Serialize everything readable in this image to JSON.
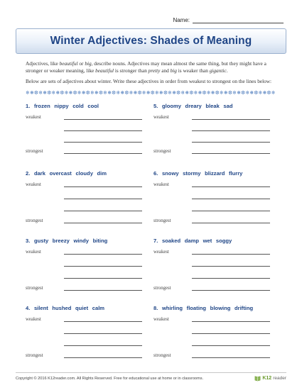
{
  "name_label": "Name:",
  "title": "Winter Adjectives: Shades of Meaning",
  "intro": {
    "p1_a": "Adjectives, like ",
    "p1_b": "beautiful",
    "p1_c": " or ",
    "p1_d": "big",
    "p1_e": ", describe nouns. Adjectives may mean almost the same thing, but they might have a stronger or weaker meaning, like ",
    "p1_f": "beautiful",
    "p1_g": " is stronger than ",
    "p1_h": "pretty",
    "p1_i": " and ",
    "p1_j": "big",
    "p1_k": " is weaker than ",
    "p1_l": "gigantic",
    "p1_m": ".",
    "p2": "Below are sets of adjectives about winter. Write these adjectives in order from weakest to strongest on the lines below:"
  },
  "labels": {
    "weakest": "weakest",
    "strongest": "strongest"
  },
  "questions": [
    {
      "title": "1.  frozen  nippy  cold  cool"
    },
    {
      "title": "5.  gloomy  dreary  bleak  sad"
    },
    {
      "title": "2.  dark  overcast  cloudy  dim"
    },
    {
      "title": "6.  snowy  stormy  blizzard  flurry"
    },
    {
      "title": "3.  gusty  breezy  windy  biting"
    },
    {
      "title": "7.  soaked  damp  wet  soggy"
    },
    {
      "title": "4.  silent  hushed  quiet  calm"
    },
    {
      "title": "8.  whirling  floating  blowing  drifting"
    }
  ],
  "footer": {
    "copyright": "Copyright © 2016  K12reader.com. All Rights Reserved. Free for educational use at home or in classrooms.",
    "logo_k12": "K12",
    "logo_reader": "reader"
  },
  "colors": {
    "title_blue": "#1f4586",
    "snowflake_blue": "#5b86c2",
    "logo_green": "#6a9a2c"
  },
  "icons": {
    "decor": "snowflake-row",
    "logo": "k12reader-logo"
  }
}
